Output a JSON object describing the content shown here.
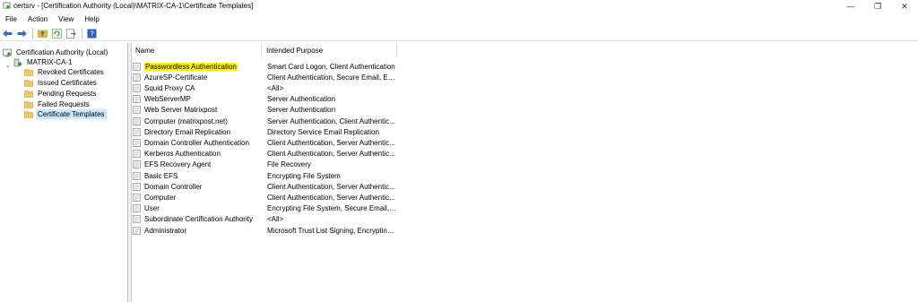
{
  "window": {
    "title": "certsrv - [Certification Authority (Local)\\MATRIX-CA-1\\Certificate Templates]",
    "controls": {
      "minimize": "—",
      "restore": "❐",
      "close": "✕"
    }
  },
  "menu": {
    "items": [
      "File",
      "Action",
      "View",
      "Help"
    ]
  },
  "toolbar": {
    "buttons": [
      "back-arrow-icon",
      "forward-arrow-icon",
      "folder-up-icon",
      "refresh-icon",
      "export-list-icon",
      "help-icon"
    ]
  },
  "tree": {
    "root": "Certification Authority (Local)",
    "ca": "MATRIX-CA-1",
    "expander": "⌄",
    "folders": [
      "Revoked Certificates",
      "Issued Certificates",
      "Pending Requests",
      "Failed Requests",
      "Certificate Templates"
    ],
    "selected": "Certificate Templates"
  },
  "list": {
    "columns": [
      "Name",
      "Intended Purpose"
    ],
    "rows": [
      {
        "name": "Passwordless Authentication",
        "purpose": "Smart Card Logon, Client Authentication",
        "highlighted": true
      },
      {
        "name": "AzureSP-Certificate",
        "purpose": "Client Authentication, Secure Email, En..."
      },
      {
        "name": "Squid Proxy CA",
        "purpose": "<All>"
      },
      {
        "name": "WebServerMP",
        "purpose": "Server Authentication"
      },
      {
        "name": " Web Server Matrixpost",
        "purpose": "Server Authentication"
      },
      {
        "name": "Computer (matrixpost.net)",
        "purpose": "Server Authentication, Client Authentic..."
      },
      {
        "name": "Directory Email Replication",
        "purpose": "Directory Service Email Replication"
      },
      {
        "name": "Domain Controller Authentication",
        "purpose": "Client Authentication, Server Authentic..."
      },
      {
        "name": "Kerberos Authentication",
        "purpose": "Client Authentication, Server Authentic..."
      },
      {
        "name": "EFS Recovery Agent",
        "purpose": "File Recovery"
      },
      {
        "name": "Basic EFS",
        "purpose": "Encrypting File System"
      },
      {
        "name": "Domain Controller",
        "purpose": "Client Authentication, Server Authentic..."
      },
      {
        "name": "Computer",
        "purpose": "Client Authentication, Server Authentic..."
      },
      {
        "name": "User",
        "purpose": "Encrypting File System, Secure Email, Cl..."
      },
      {
        "name": "Subordinate Certification Authority",
        "purpose": "<All>"
      },
      {
        "name": "Administrator",
        "purpose": "Microsoft Trust List Signing, Encrypting ..."
      }
    ]
  },
  "colors": {
    "selection": "#cce8ff",
    "highlight": "#fff200",
    "folder": "#e8b84a"
  }
}
